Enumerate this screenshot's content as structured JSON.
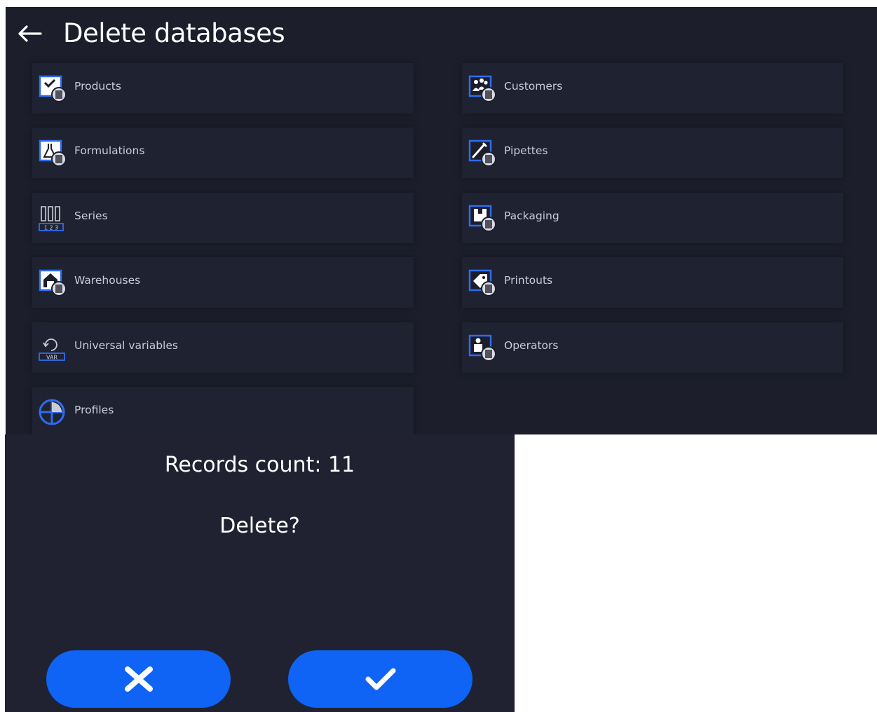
{
  "header": {
    "title": "Delete databases",
    "back_icon": "arrow-left-icon"
  },
  "databases": [
    {
      "label": "Products",
      "icon": "products-db-icon"
    },
    {
      "label": "Customers",
      "icon": "customers-db-icon"
    },
    {
      "label": "Formulations",
      "icon": "formulations-db-icon"
    },
    {
      "label": "Pipettes",
      "icon": "pipettes-db-icon"
    },
    {
      "label": "Series",
      "icon": "series-icon"
    },
    {
      "label": "Packaging",
      "icon": "packaging-db-icon"
    },
    {
      "label": "Warehouses",
      "icon": "warehouses-db-icon"
    },
    {
      "label": "Printouts",
      "icon": "printouts-db-icon"
    },
    {
      "label": "Universal variables",
      "icon": "var-icon"
    },
    {
      "label": "Operators",
      "icon": "operators-db-icon"
    },
    {
      "label": "Profiles",
      "icon": "profiles-icon"
    }
  ],
  "dialog": {
    "records_count": "Records count: 11",
    "question": "Delete?",
    "cancel_icon": "close-icon",
    "confirm_icon": "check-icon"
  },
  "colors": {
    "accent": "#0f63f5",
    "background": "#1c1e2b",
    "tile": "#1f2230",
    "icon_blue": "#2f6cf0"
  }
}
